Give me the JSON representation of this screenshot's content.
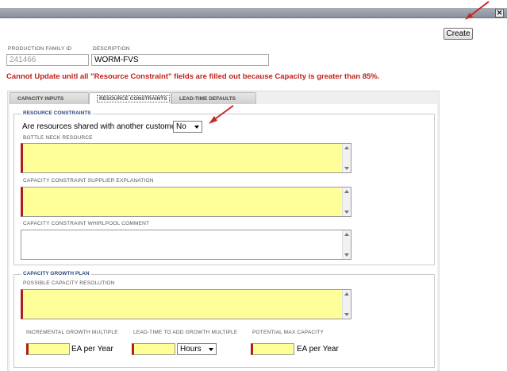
{
  "window": {
    "close_glyph": "✕"
  },
  "toolbar": {
    "create_label": "Create"
  },
  "header": {
    "family_id_label": "PRODUCTION FAMILY ID",
    "family_id_value": "241466",
    "description_label": "DESCRIPTION",
    "description_value": "WORM-FVS"
  },
  "error_message": "Cannot Update unitl all \"Resource Constraint\" fields are filled out because Capacity is greater than 85%.",
  "tabs": [
    {
      "label": "CAPACITY INPUTS",
      "active": false
    },
    {
      "label": "RESOURCE CONSTRAINTS",
      "active": true
    },
    {
      "label": "LEAD-TIME DEFAULTS",
      "active": false
    }
  ],
  "resource_constraints": {
    "legend": "RESOURCE CONSTRAINTS",
    "shared_question": "Are resources shared with another customer?",
    "shared_value": "No",
    "bottleneck_label": "BOTTLE NECK RESOURCE",
    "supplier_expl_label": "CAPACITY CONSTRAINT SUPPLIER EXPLANATION",
    "whirlpool_comment_label": "CAPACITY CONSTRAINT WHIRLPOOL COMMENT"
  },
  "growth_plan": {
    "legend": "CAPACITY GROWTH PLAN",
    "resolution_label": "POSSIBLE CAPACITY RESOLUTION",
    "incremental_label": "INCREMENTAL GROWTH MULTIPLE",
    "leadtime_label": "LEAD-TIME TO ADD GROWTH MULTIPLE",
    "max_capacity_label": "POTENTIAL MAX CAPACITY",
    "incremental_unit": "EA per Year",
    "leadtime_unit": "Hours",
    "max_capacity_unit": "EA per Year"
  },
  "colors": {
    "required_fill": "#ffff99",
    "required_marker": "#b01d1d",
    "error_text": "#c0211b",
    "legend_text": "#2b4a7c"
  },
  "icons": {
    "close": "close-icon",
    "arrow": "red-arrow-annotation",
    "dropdown": "chevron-down-icon"
  }
}
